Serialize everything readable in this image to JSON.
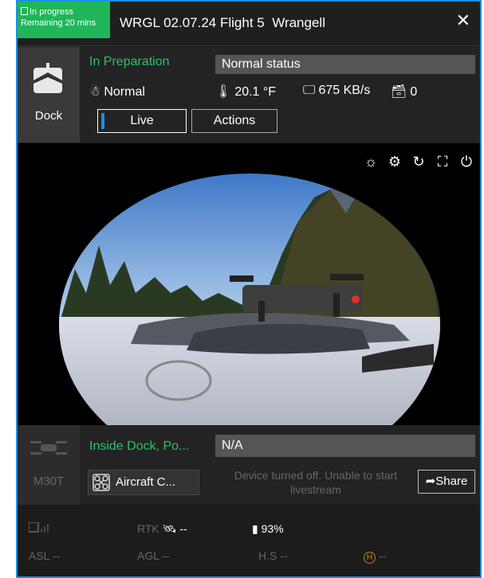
{
  "task": {
    "status_line": "In progress",
    "remaining_line": "Remaining 20 mins",
    "name": "WRGL 02.07.24 Flight 5",
    "site": "Wrangell",
    "close_label": "✕"
  },
  "dock": {
    "label": "Dock",
    "state": "In Preparation",
    "status": "Normal status",
    "weather": "Normal",
    "temperature": "20.1 °F",
    "network_speed": "675 KB/s",
    "storage_count": "0",
    "tabs": {
      "live": "Live",
      "actions": "Actions"
    }
  },
  "video": {
    "tools": [
      "light-icon",
      "settings-icon",
      "refresh-icon",
      "fullscreen-icon",
      "power-icon"
    ]
  },
  "aircraft": {
    "model": "M30T",
    "state": "Inside Dock, Po...",
    "status": "N/A",
    "camera_button": "Aircraft C...",
    "offline_message": "Device turned off. Unable to start livestream",
    "share_label": "Share"
  },
  "telemetry": {
    "rtk_label": "RTK",
    "rtk_value": "--",
    "battery": "93%",
    "asl": "ASL --",
    "agl": "AGL --",
    "hs": "H.S --",
    "home_value": "--"
  },
  "colors": {
    "accent": "#1a8fe6",
    "success": "#1fb65a",
    "background": "#1f1f1f"
  }
}
